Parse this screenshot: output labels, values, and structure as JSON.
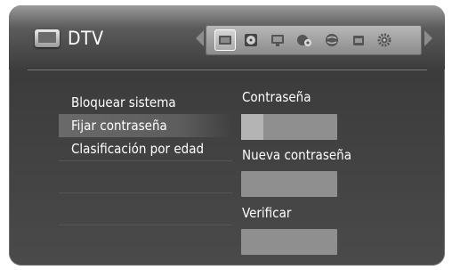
{
  "header": {
    "title": "DTV",
    "icons": [
      "tv-icon",
      "disc-icon",
      "monitor-icon",
      "audio-settings-icon",
      "globe-icon",
      "lock-icon",
      "gear-icon"
    ]
  },
  "menu": {
    "items": [
      "Bloquear sistema",
      "Fijar contraseña",
      "Clasificación por edad"
    ],
    "selected_index": 1
  },
  "form": {
    "password_label": "Contraseña",
    "new_password_label": "Nueva contraseña",
    "verify_label": "Verificar"
  }
}
